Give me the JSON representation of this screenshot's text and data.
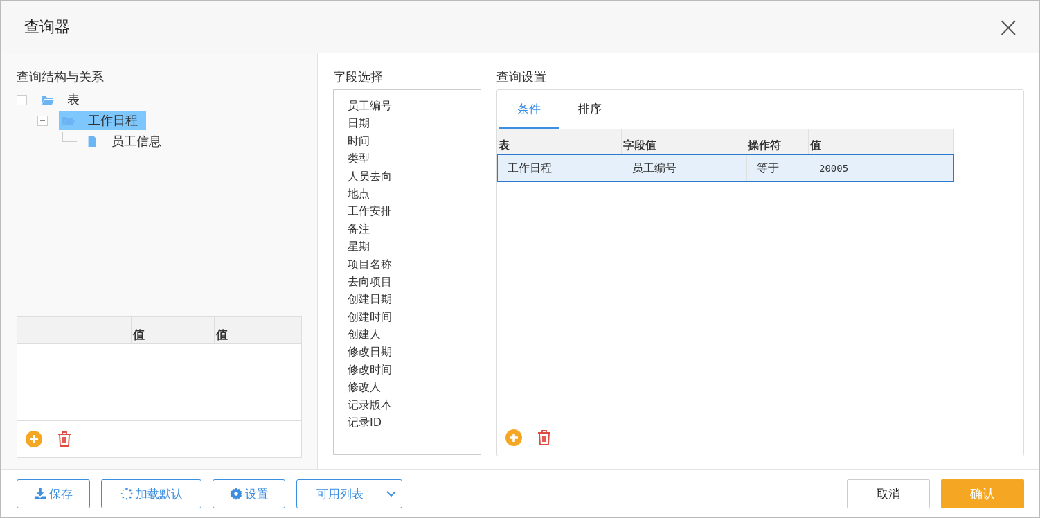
{
  "window": {
    "title": "查询器",
    "close": "×"
  },
  "structure": {
    "title": "查询结构与关系",
    "tree": [
      {
        "label": "表",
        "kind": "folder",
        "expanded": true,
        "selected": false,
        "children": [
          {
            "label": "工作日程",
            "kind": "folder",
            "expanded": true,
            "selected": true,
            "children": [
              {
                "label": "员工信息",
                "kind": "file",
                "selected": false
              }
            ]
          }
        ]
      }
    ],
    "grid": {
      "columns": [
        "值",
        "值"
      ]
    }
  },
  "fields": {
    "title": "字段选择",
    "items": [
      "员工编号",
      "日期",
      "时间",
      "类型",
      "人员去向",
      "地点",
      "工作安排",
      "备注",
      "星期",
      "项目名称",
      "去向项目",
      "创建日期",
      "创建时间",
      "创建人",
      "修改日期",
      "修改时间",
      "修改人",
      "记录版本",
      "记录ID"
    ]
  },
  "settings": {
    "title": "查询设置",
    "tabs": [
      {
        "label": "条件",
        "selected": true
      },
      {
        "label": "排序",
        "selected": false
      }
    ],
    "table": {
      "columns": [
        "表",
        "字段值",
        "操作符",
        "值"
      ],
      "rows": [
        {
          "cells": [
            "工作日程",
            "员工编号",
            "等于",
            "20005"
          ],
          "selected": true
        }
      ]
    }
  },
  "footer": {
    "buttons": [
      {
        "label": "保存",
        "kind": "download"
      },
      {
        "label": "加载默认",
        "kind": "spinner"
      },
      {
        "label": "设置",
        "kind": "gear"
      },
      {
        "label": "可用列表",
        "kind": "dropdown"
      }
    ],
    "cancel": "取消",
    "confirm": "确认"
  }
}
